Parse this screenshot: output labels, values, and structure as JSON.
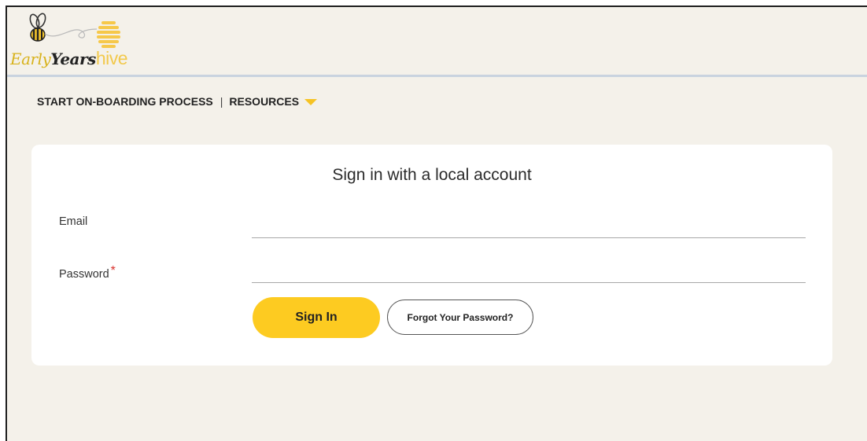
{
  "logo": {
    "early": "Early",
    "years": "Years",
    "hive": "hive"
  },
  "nav": {
    "onboarding": "START ON-BOARDING PROCESS",
    "separator": "|",
    "resources": "RESOURCES"
  },
  "form": {
    "title": "Sign in with a local account",
    "email_label": "Email",
    "email_value": "",
    "password_label": "Password",
    "password_required_marker": "*",
    "password_value": "",
    "signin_label": "Sign In",
    "forgot_label": "Forgot Your Password?"
  },
  "colors": {
    "background": "#f4f1ea",
    "accent_yellow": "#fdcb21",
    "required_red": "#d9302c",
    "header_rule": "#c9d3df"
  },
  "icons": {
    "logo_mark": "bee-honeycomb-icon",
    "resources_caret": "caret-down-icon"
  }
}
